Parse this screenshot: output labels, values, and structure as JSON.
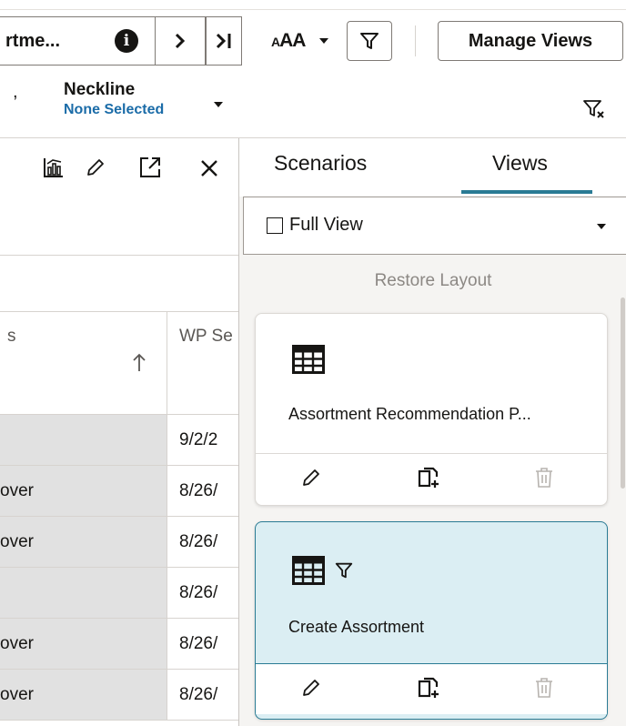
{
  "toolbar": {
    "view_name_truncated": "rtme...",
    "font_size_label": "AA",
    "manage_views_label": "Manage Views"
  },
  "filterbar": {
    "prev_chevron": "ˇ",
    "neckline_label": "Neckline",
    "neckline_value": "None Selected"
  },
  "grid": {
    "col_a_header": "s",
    "col_b_header": "WP Se",
    "rows": [
      {
        "a": "",
        "b": "9/2/2"
      },
      {
        "a": "over",
        "b": "8/26/"
      },
      {
        "a": "over",
        "b": "8/26/"
      },
      {
        "a": "",
        "b": "8/26/"
      },
      {
        "a": "over",
        "b": "8/26/"
      },
      {
        "a": "over",
        "b": "8/26/"
      }
    ]
  },
  "panel": {
    "tabs": [
      "Scenarios",
      "Views"
    ],
    "active_tab": "Views",
    "dropdown_label": "Full View",
    "restore_layout": "Restore Layout",
    "cards": [
      {
        "title": "Assortment Recommendation P...",
        "has_filter": false,
        "selected": false
      },
      {
        "title": "Create Assortment",
        "has_filter": true,
        "selected": true
      }
    ]
  },
  "colors": {
    "accent": "#2a7b94",
    "link_blue": "#1b6ca8",
    "selected_card_bg": "#dbeef3",
    "grid_gray": "#e1e1e1"
  },
  "icons": {
    "info": "info-icon",
    "next": "chevron-right-icon",
    "last": "last-page-icon",
    "font_size": "font-size-icon",
    "filter": "filter-icon",
    "clear_filter": "clear-filter-icon",
    "chart": "chart-icon",
    "edit": "pencil-icon",
    "expand": "expand-icon",
    "close": "close-icon",
    "sort": "sort-ascending-icon",
    "table": "table-icon",
    "duplicate": "duplicate-icon",
    "delete": "trash-icon"
  }
}
